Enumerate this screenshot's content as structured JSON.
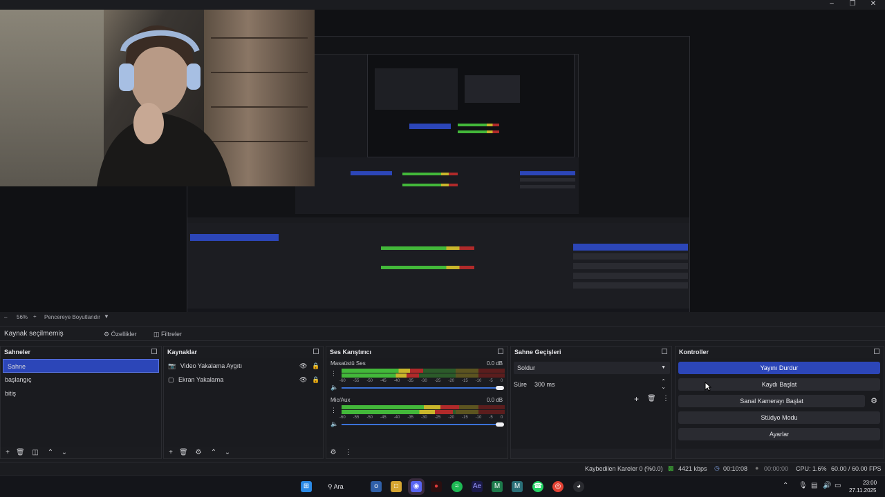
{
  "window": {
    "minimize_icon": "minimize-icon",
    "maximize_icon": "restore-icon",
    "close_icon": "close-icon"
  },
  "zoom_bar": {
    "zoom": "56%",
    "fit_label": "Pencereye Boyutlandır"
  },
  "source_toolbar": {
    "status": "Kaynak seçilmemiş",
    "properties": "Özellikler",
    "filters": "Filtreler"
  },
  "scenes": {
    "title": "Sahneler",
    "items": [
      {
        "label": "Sahne",
        "active": true
      },
      {
        "label": "başlangıç"
      },
      {
        "label": "bitiş"
      }
    ]
  },
  "sources": {
    "title": "Kaynaklar",
    "items": [
      {
        "label": "Video Yakalama Aygıtı",
        "icon": "camera-icon"
      },
      {
        "label": "Ekran Yakalama",
        "icon": "monitor-icon"
      }
    ]
  },
  "mixer": {
    "title": "Ses Karıştırıcı",
    "scale": [
      "-60",
      "-55",
      "-50",
      "-45",
      "-40",
      "-35",
      "-30",
      "-25",
      "-20",
      "-15",
      "-10",
      "-5",
      "0"
    ],
    "channels": [
      {
        "name": "Masaüstü Ses",
        "db": "0.0 dB",
        "level": 0.5,
        "volume": 1.0
      },
      {
        "name": "Mic/Aux",
        "db": "0.0 dB",
        "level": 0.72,
        "volume": 1.0
      }
    ]
  },
  "transitions": {
    "title": "Sahne Geçişleri",
    "type": "Soldur",
    "duration_label": "Süre",
    "duration": "300 ms"
  },
  "controls": {
    "title": "Kontroller",
    "buttons": [
      "Yayını Durdur",
      "Kaydı Başlat",
      "Sanal Kamerayı Başlat",
      "Stüdyo Modu",
      "Ayarlar"
    ]
  },
  "status": {
    "dropped": "Kaybedilen Kareler 0 (%0.0)",
    "bitrate": "4421 kbps",
    "stream_time": "00:10:08",
    "rec_time": "00:00:00",
    "cpu": "CPU: 1.6%",
    "fps": "60.00 / 60.00 FPS"
  },
  "taskbar": {
    "search": "Ara",
    "time": "23:00",
    "date": "27.11.2025"
  },
  "colors": {
    "accent": "#2c46b8",
    "meter_green": "#43b83a",
    "meter_yellow": "#c9b62b",
    "meter_red": "#b02a2a"
  }
}
